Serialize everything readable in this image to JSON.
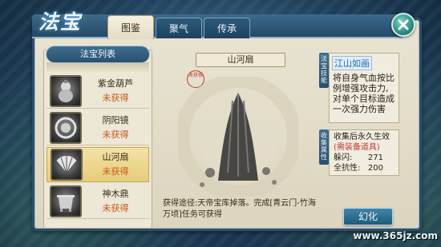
{
  "header": {
    "title": "法宝",
    "tabs": [
      {
        "label": "图鉴",
        "active": true
      },
      {
        "label": "聚气",
        "active": false
      },
      {
        "label": "传承",
        "active": false
      }
    ]
  },
  "list": {
    "title": "法宝列表",
    "items": [
      {
        "name": "紫金葫芦",
        "status": "未获得",
        "icon": "gourd-icon"
      },
      {
        "name": "阴阳镜",
        "status": "未获得",
        "icon": "mirror-icon"
      },
      {
        "name": "山河扇",
        "status": "未获得",
        "icon": "fan-icon",
        "selected": true
      },
      {
        "name": "神木鼎",
        "status": "未获得",
        "icon": "cauldron-icon"
      }
    ]
  },
  "detail": {
    "title": "山河扇",
    "seal_text": "未获得",
    "acquire_text": "获得途径:天帝宝库掉落。完成[青云门-竹海万顷]任务可获得"
  },
  "info": {
    "skill_tag": "法宝技能",
    "skill_name": "江山如画",
    "skill_desc": "将自身气血按比例增强攻击力,对单个目标造成一次强力伤害",
    "collect_tag": "收集属性",
    "collect_title": "收集后永久生效",
    "collect_note": "(需装备道具)",
    "stats": [
      {
        "label": "躲闪:",
        "value": "271"
      },
      {
        "label": "全抗性:",
        "value": "200"
      }
    ],
    "refine_label": "幻化"
  },
  "watermark": "www.365jz.com",
  "colors": {
    "accent_blue": "#2a5170",
    "parchment": "#e9e4d3",
    "status_orange": "#c35a1c",
    "skill_blue": "#1f6fb8",
    "selected_gold": "#e6cd7a"
  }
}
